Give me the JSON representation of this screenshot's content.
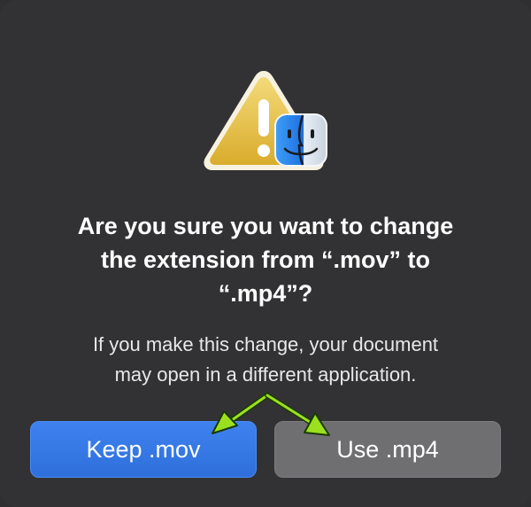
{
  "dialog": {
    "title_line1": "Are you sure you want to change",
    "title_line2": "the extension from “.mov” to",
    "title_line3": "“.mp4”?",
    "message_line1": "If you make this change, your document",
    "message_line2": "may open in a different application.",
    "icons": [
      "warning-icon",
      "finder-icon"
    ]
  },
  "buttons": {
    "keep_label": "Keep .mov",
    "use_label": "Use .mp4"
  },
  "colors": {
    "primary_button": "#3478f6",
    "secondary_button": "#6f6f72",
    "background": "#323234",
    "annotation_arrow": "#9be01e"
  }
}
